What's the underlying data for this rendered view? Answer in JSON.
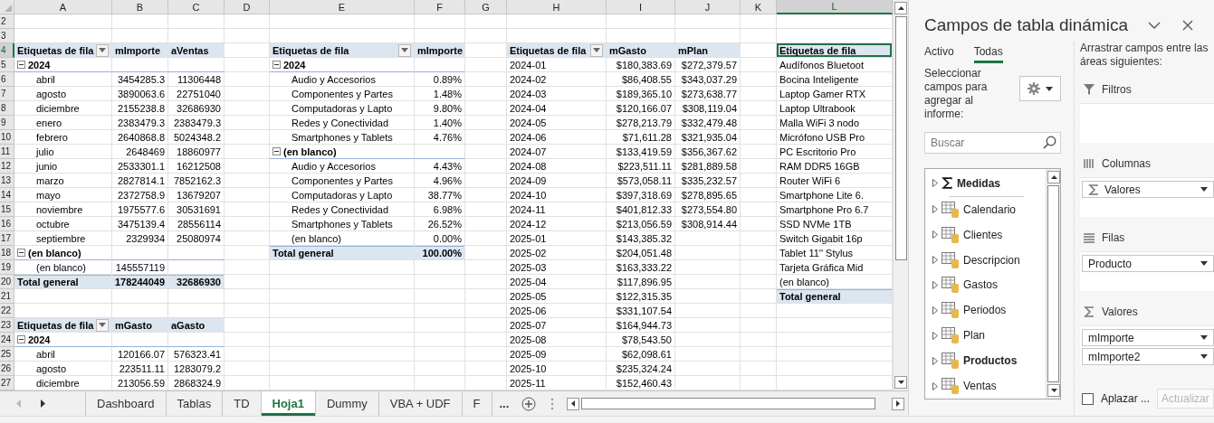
{
  "sheet": {
    "columns": [
      "A",
      "B",
      "C",
      "D",
      "E",
      "F",
      "G",
      "H",
      "I",
      "J",
      "K",
      "L"
    ],
    "rows": [
      {
        "number": "2",
        "cells": [
          null,
          null,
          null,
          null,
          null,
          null,
          null,
          null,
          null,
          null,
          null,
          null
        ]
      },
      {
        "number": "3",
        "cells": [
          null,
          null,
          null,
          null,
          null,
          null,
          null,
          null,
          null,
          null,
          null,
          null
        ]
      },
      {
        "number": "4",
        "cells": [
          {
            "kind": "header_filter",
            "text": "Etiquetas de fila"
          },
          {
            "kind": "header",
            "text": "mImporte"
          },
          {
            "kind": "header",
            "text": "aVentas"
          },
          null,
          {
            "kind": "header_filter",
            "text": "Etiquetas de fila"
          },
          {
            "kind": "header",
            "text": "mImporte"
          },
          null,
          {
            "kind": "header_filter",
            "text": "Etiquetas de fila"
          },
          {
            "kind": "header",
            "text": "mGasto"
          },
          {
            "kind": "header",
            "text": "mPlan"
          },
          null,
          {
            "kind": "header",
            "text": "Etiquetas de fila",
            "active": true
          }
        ]
      },
      {
        "number": "5",
        "cells": [
          {
            "kind": "group",
            "text": "2024"
          },
          {
            "kind": "pad"
          },
          {
            "kind": "pad"
          },
          null,
          {
            "kind": "group",
            "text": "2024"
          },
          {
            "kind": "pad"
          },
          null,
          {
            "kind": "plain",
            "text": "2024-01"
          },
          {
            "kind": "value",
            "text": "$180,383.69"
          },
          {
            "kind": "value",
            "text": "$272,379.57"
          },
          null,
          {
            "kind": "plain",
            "text": "Audífonos Bluetoot"
          }
        ]
      },
      {
        "number": "6",
        "cells": [
          {
            "kind": "item",
            "text": "abril"
          },
          {
            "kind": "value",
            "text": "3454285.3"
          },
          {
            "kind": "value",
            "text": "11306448"
          },
          null,
          {
            "kind": "item",
            "text": "Audio y Accesorios"
          },
          {
            "kind": "value",
            "text": "0.89%"
          },
          null,
          {
            "kind": "plain",
            "text": "2024-02"
          },
          {
            "kind": "value",
            "text": "$86,408.55"
          },
          {
            "kind": "value",
            "text": "$343,037.29"
          },
          null,
          {
            "kind": "plain",
            "text": "Bocina Inteligente"
          }
        ]
      },
      {
        "number": "7",
        "cells": [
          {
            "kind": "item",
            "text": "agosto"
          },
          {
            "kind": "value",
            "text": "3890063.6"
          },
          {
            "kind": "value",
            "text": "22751040"
          },
          null,
          {
            "kind": "item",
            "text": "Componentes y Partes"
          },
          {
            "kind": "value",
            "text": "1.48%"
          },
          null,
          {
            "kind": "plain",
            "text": "2024-03"
          },
          {
            "kind": "value",
            "text": "$189,365.10"
          },
          {
            "kind": "value",
            "text": "$273,638.77"
          },
          null,
          {
            "kind": "plain",
            "text": "Laptop Gamer RTX"
          }
        ]
      },
      {
        "number": "8",
        "cells": [
          {
            "kind": "item",
            "text": "diciembre"
          },
          {
            "kind": "value",
            "text": "2155238.8"
          },
          {
            "kind": "value",
            "text": "32686930"
          },
          null,
          {
            "kind": "item",
            "text": "Computadoras y Lapto"
          },
          {
            "kind": "value",
            "text": "9.80%"
          },
          null,
          {
            "kind": "plain",
            "text": "2024-04"
          },
          {
            "kind": "value",
            "text": "$120,166.07"
          },
          {
            "kind": "value",
            "text": "$308,119.04"
          },
          null,
          {
            "kind": "plain",
            "text": "Laptop Ultrabook"
          }
        ]
      },
      {
        "number": "9",
        "cells": [
          {
            "kind": "item",
            "text": "enero"
          },
          {
            "kind": "value",
            "text": "2383479.3"
          },
          {
            "kind": "value",
            "text": "2383479.3"
          },
          null,
          {
            "kind": "item",
            "text": "Redes y Conectividad"
          },
          {
            "kind": "value",
            "text": "1.40%"
          },
          null,
          {
            "kind": "plain",
            "text": "2024-05"
          },
          {
            "kind": "value",
            "text": "$278,213.79"
          },
          {
            "kind": "value",
            "text": "$332,479.48"
          },
          null,
          {
            "kind": "plain",
            "text": "Malla WiFi 3 nodo"
          }
        ]
      },
      {
        "number": "10",
        "cells": [
          {
            "kind": "item",
            "text": "febrero"
          },
          {
            "kind": "value",
            "text": "2640868.8"
          },
          {
            "kind": "value",
            "text": "5024348.2"
          },
          null,
          {
            "kind": "item",
            "text": "Smartphones y Tablets"
          },
          {
            "kind": "value",
            "text": "4.76%"
          },
          null,
          {
            "kind": "plain",
            "text": "2024-06"
          },
          {
            "kind": "value",
            "text": "$71,611.28"
          },
          {
            "kind": "value",
            "text": "$321,935.04"
          },
          null,
          {
            "kind": "plain",
            "text": "Micrófono USB Pro"
          }
        ]
      },
      {
        "number": "11",
        "cells": [
          {
            "kind": "item",
            "text": "julio"
          },
          {
            "kind": "value",
            "text": "2648469"
          },
          {
            "kind": "value",
            "text": "18860977"
          },
          null,
          {
            "kind": "group",
            "text": "(en blanco)"
          },
          {
            "kind": "pad"
          },
          null,
          {
            "kind": "plain",
            "text": "2024-07"
          },
          {
            "kind": "value",
            "text": "$133,419.59"
          },
          {
            "kind": "value",
            "text": "$356,367.62"
          },
          null,
          {
            "kind": "plain",
            "text": "PC Escritorio Pro"
          }
        ]
      },
      {
        "number": "12",
        "cells": [
          {
            "kind": "item",
            "text": "junio"
          },
          {
            "kind": "value",
            "text": "2533301.1"
          },
          {
            "kind": "value",
            "text": "16212508"
          },
          null,
          {
            "kind": "item",
            "text": "Audio y Accesorios"
          },
          {
            "kind": "value",
            "text": "4.43%"
          },
          null,
          {
            "kind": "plain",
            "text": "2024-08"
          },
          {
            "kind": "value",
            "text": "$223,511.11"
          },
          {
            "kind": "value",
            "text": "$281,889.58"
          },
          null,
          {
            "kind": "plain",
            "text": "RAM DDR5 16GB"
          }
        ]
      },
      {
        "number": "13",
        "cells": [
          {
            "kind": "item",
            "text": "marzo"
          },
          {
            "kind": "value",
            "text": "2827814.1"
          },
          {
            "kind": "value",
            "text": "7852162.3"
          },
          null,
          {
            "kind": "item",
            "text": "Componentes y Partes"
          },
          {
            "kind": "value",
            "text": "4.96%"
          },
          null,
          {
            "kind": "plain",
            "text": "2024-09"
          },
          {
            "kind": "value",
            "text": "$573,058.11"
          },
          {
            "kind": "value",
            "text": "$335,232.57"
          },
          null,
          {
            "kind": "plain",
            "text": "Router WiFi 6"
          }
        ]
      },
      {
        "number": "14",
        "cells": [
          {
            "kind": "item",
            "text": "mayo"
          },
          {
            "kind": "value",
            "text": "2372758.9"
          },
          {
            "kind": "value",
            "text": "13679207"
          },
          null,
          {
            "kind": "item",
            "text": "Computadoras y Lapto"
          },
          {
            "kind": "value",
            "text": "38.77%"
          },
          null,
          {
            "kind": "plain",
            "text": "2024-10"
          },
          {
            "kind": "value",
            "text": "$397,318.69"
          },
          {
            "kind": "value",
            "text": "$278,895.65"
          },
          null,
          {
            "kind": "plain",
            "text": "Smartphone Lite 6."
          }
        ]
      },
      {
        "number": "15",
        "cells": [
          {
            "kind": "item",
            "text": "noviembre"
          },
          {
            "kind": "value",
            "text": "1975577.6"
          },
          {
            "kind": "value",
            "text": "30531691"
          },
          null,
          {
            "kind": "item",
            "text": "Redes y Conectividad"
          },
          {
            "kind": "value",
            "text": "6.98%"
          },
          null,
          {
            "kind": "plain",
            "text": "2024-11"
          },
          {
            "kind": "value",
            "text": "$401,812.33"
          },
          {
            "kind": "value",
            "text": "$273,554.80"
          },
          null,
          {
            "kind": "plain",
            "text": "Smartphone Pro 6.7"
          }
        ]
      },
      {
        "number": "16",
        "cells": [
          {
            "kind": "item",
            "text": "octubre"
          },
          {
            "kind": "value",
            "text": "3475139.4"
          },
          {
            "kind": "value",
            "text": "28556114"
          },
          null,
          {
            "kind": "item",
            "text": "Smartphones y Tablets"
          },
          {
            "kind": "value",
            "text": "26.52%"
          },
          null,
          {
            "kind": "plain",
            "text": "2024-12"
          },
          {
            "kind": "value",
            "text": "$213,056.59"
          },
          {
            "kind": "value",
            "text": "$308,914.44"
          },
          null,
          {
            "kind": "plain",
            "text": "SSD NVMe 1TB"
          }
        ]
      },
      {
        "number": "17",
        "cells": [
          {
            "kind": "item",
            "text": "septiembre"
          },
          {
            "kind": "value",
            "text": "2329934"
          },
          {
            "kind": "value",
            "text": "25080974"
          },
          null,
          {
            "kind": "item",
            "text": "(en blanco)"
          },
          {
            "kind": "value",
            "text": "0.00%"
          },
          null,
          {
            "kind": "plain",
            "text": "2025-01"
          },
          {
            "kind": "value",
            "text": "$143,385.32"
          },
          null,
          null,
          {
            "kind": "plain",
            "text": "Switch Gigabit 16p"
          }
        ]
      },
      {
        "number": "18",
        "cells": [
          {
            "kind": "group",
            "text": "(en blanco)"
          },
          {
            "kind": "pad"
          },
          {
            "kind": "pad"
          },
          null,
          {
            "kind": "total",
            "text": "Total general"
          },
          {
            "kind": "total_value",
            "text": "100.00%"
          },
          null,
          {
            "kind": "plain",
            "text": "2025-02"
          },
          {
            "kind": "value",
            "text": "$204,051.48"
          },
          null,
          null,
          {
            "kind": "plain",
            "text": "Tablet 11'' Stylus"
          }
        ]
      },
      {
        "number": "19",
        "cells": [
          {
            "kind": "item",
            "text": "(en blanco)"
          },
          {
            "kind": "value",
            "text": "145557119"
          },
          null,
          null,
          null,
          null,
          null,
          {
            "kind": "plain",
            "text": "2025-03"
          },
          {
            "kind": "value",
            "text": "$163,333.22"
          },
          null,
          null,
          {
            "kind": "plain",
            "text": "Tarjeta Gráfica Mid"
          }
        ]
      },
      {
        "number": "20",
        "cells": [
          {
            "kind": "total",
            "text": "Total general"
          },
          {
            "kind": "total_value",
            "text": "178244049"
          },
          {
            "kind": "total_value",
            "text": "32686930"
          },
          null,
          null,
          null,
          null,
          {
            "kind": "plain",
            "text": "2025-04"
          },
          {
            "kind": "value",
            "text": "$117,896.95"
          },
          null,
          null,
          {
            "kind": "plain",
            "text": "(en blanco)"
          }
        ]
      },
      {
        "number": "21",
        "cells": [
          null,
          null,
          null,
          null,
          null,
          null,
          null,
          {
            "kind": "plain",
            "text": "2025-05"
          },
          {
            "kind": "value",
            "text": "$122,315.35"
          },
          null,
          null,
          {
            "kind": "total",
            "text": "Total general"
          }
        ]
      },
      {
        "number": "22",
        "cells": [
          null,
          null,
          null,
          null,
          null,
          null,
          null,
          {
            "kind": "plain",
            "text": "2025-06"
          },
          {
            "kind": "value",
            "text": "$331,107.54"
          },
          null,
          null,
          null
        ]
      },
      {
        "number": "23",
        "cells": [
          {
            "kind": "header_filter",
            "text": "Etiquetas de fila"
          },
          {
            "kind": "header",
            "text": "mGasto"
          },
          {
            "kind": "header",
            "text": "aGasto"
          },
          null,
          null,
          null,
          null,
          {
            "kind": "plain",
            "text": "2025-07"
          },
          {
            "kind": "value",
            "text": "$164,944.73"
          },
          null,
          null,
          null
        ]
      },
      {
        "number": "24",
        "cells": [
          {
            "kind": "group",
            "text": "2024"
          },
          {
            "kind": "pad"
          },
          {
            "kind": "pad"
          },
          null,
          null,
          null,
          null,
          {
            "kind": "plain",
            "text": "2025-08"
          },
          {
            "kind": "value",
            "text": "$78,543.50"
          },
          null,
          null,
          null
        ]
      },
      {
        "number": "25",
        "cells": [
          {
            "kind": "item",
            "text": "abril"
          },
          {
            "kind": "value",
            "text": "120166.07"
          },
          {
            "kind": "value",
            "text": "576323.41"
          },
          null,
          null,
          null,
          null,
          {
            "kind": "plain",
            "text": "2025-09"
          },
          {
            "kind": "value",
            "text": "$62,098.61"
          },
          null,
          null,
          null
        ]
      },
      {
        "number": "26",
        "cells": [
          {
            "kind": "item",
            "text": "agosto"
          },
          {
            "kind": "value",
            "text": "223511.11"
          },
          {
            "kind": "value",
            "text": "1283079.2"
          },
          null,
          null,
          null,
          null,
          {
            "kind": "plain",
            "text": "2025-10"
          },
          {
            "kind": "value",
            "text": "$235,324.24"
          },
          null,
          null,
          null
        ]
      },
      {
        "number": "27",
        "cells": [
          {
            "kind": "item",
            "text": "diciembre"
          },
          {
            "kind": "value",
            "text": "213056.59"
          },
          {
            "kind": "value",
            "text": "2868324.9"
          },
          null,
          null,
          null,
          null,
          {
            "kind": "plain",
            "text": "2025-11"
          },
          {
            "kind": "value",
            "text": "$152,460.43"
          },
          null,
          null,
          null
        ]
      }
    ]
  },
  "sheet_tabs": [
    {
      "label": "Dashboard",
      "selected": false
    },
    {
      "label": "Tablas",
      "selected": false
    },
    {
      "label": "TD",
      "selected": false
    },
    {
      "label": "Hoja1",
      "selected": true
    },
    {
      "label": "Dummy",
      "selected": false
    },
    {
      "label": "VBA + UDF",
      "selected": false
    },
    {
      "label": "F",
      "selected": false
    }
  ],
  "more_tabs": "...",
  "pivot_pane": {
    "title": "Campos de tabla dinámica",
    "tabs": [
      {
        "label": "Activo",
        "selected": false
      },
      {
        "label": "Todas",
        "selected": true
      }
    ],
    "instructions": "Seleccionar campos para agregar al informe:",
    "search": {
      "placeholder": "Buscar"
    },
    "fields": [
      {
        "label": "Medidas",
        "kind": "measures",
        "bold": true
      },
      {
        "label": "Calendario",
        "kind": "table",
        "bold": false
      },
      {
        "label": "Clientes",
        "kind": "table",
        "bold": false
      },
      {
        "label": "Descripcion",
        "kind": "table",
        "bold": false
      },
      {
        "label": "Gastos",
        "kind": "table",
        "bold": false
      },
      {
        "label": "Periodos",
        "kind": "table",
        "bold": false
      },
      {
        "label": "Plan",
        "kind": "table",
        "bold": false
      },
      {
        "label": "Productos",
        "kind": "table",
        "bold": true
      },
      {
        "label": "Ventas",
        "kind": "table",
        "bold": false
      }
    ],
    "drag_hint": "Arrastrar campos entre las áreas siguientes:",
    "areas": [
      {
        "kind": "filters",
        "label": "Filtros"
      },
      {
        "kind": "columns",
        "label": "Columnas",
        "items": [
          {
            "label": "Valores",
            "kind": "values"
          }
        ]
      },
      {
        "kind": "rows",
        "label": "Filas",
        "items": [
          {
            "label": "Producto",
            "kind": "field"
          }
        ]
      },
      {
        "kind": "values",
        "label": "Valores",
        "items": [
          {
            "label": "mImporte",
            "kind": "field"
          },
          {
            "label": "mImporte2",
            "kind": "field"
          }
        ]
      }
    ],
    "defer": {
      "label": "Aplazar ...",
      "checked": false
    },
    "update_button": {
      "label": "Actualizar",
      "disabled": true
    }
  }
}
